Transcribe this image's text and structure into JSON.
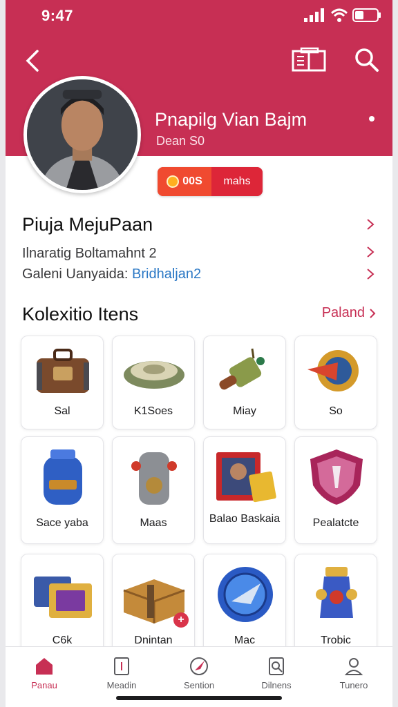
{
  "status_bar": {
    "time": "9:47"
  },
  "header": {
    "back_icon": "chevron-left-icon",
    "book_icon": "book-icon",
    "search_icon": "search-icon"
  },
  "profile": {
    "name": "Pnapilg Vian Bajm",
    "subtitle": "Dean S0",
    "badge_left": "00S",
    "badge_right": "mahs"
  },
  "info": {
    "heading": "Piuja MejuPaan",
    "rows": [
      {
        "text": "Ilnaratig Boltamahnt 2",
        "highlight": ""
      },
      {
        "label": "Galeni Uanyaida:",
        "highlight": "Bridhaljan2"
      }
    ]
  },
  "collection": {
    "title": "Kolexitio Itens",
    "link": "Paland",
    "items": [
      {
        "label": "Sal",
        "icon": "suitcase-icon"
      },
      {
        "label": "K1Soes",
        "icon": "disc-artifact-icon"
      },
      {
        "label": "Miay",
        "icon": "scroll-rod-icon"
      },
      {
        "label": "So",
        "icon": "winged-emblem-icon"
      },
      {
        "label": "Sace yaba",
        "icon": "blue-jar-icon"
      },
      {
        "label": "Maas",
        "icon": "armor-icon"
      },
      {
        "label": "Balao Baskaia",
        "icon": "portrait-card-icon"
      },
      {
        "label": "Pealatcte",
        "icon": "shield-crest-icon"
      },
      {
        "label": "C6k",
        "icon": "card-pack-icon"
      },
      {
        "label": "Dnintan",
        "icon": "wooden-crate-icon"
      },
      {
        "label": "Mac",
        "icon": "blue-medal-icon"
      },
      {
        "label": "Trobic",
        "icon": "trophy-vase-icon"
      }
    ]
  },
  "tabbar": {
    "tabs": [
      {
        "label": "Panau",
        "icon": "home-icon",
        "active": true
      },
      {
        "label": "Meadin",
        "icon": "document-icon",
        "active": false
      },
      {
        "label": "Sention",
        "icon": "compass-icon",
        "active": false
      },
      {
        "label": "Dilnens",
        "icon": "search-doc-icon",
        "active": false
      },
      {
        "label": "Tunero",
        "icon": "profile-icon",
        "active": false
      }
    ]
  },
  "colors": {
    "brand": "#c72f54",
    "badge": "#e8303a",
    "link": "#2b78c5"
  }
}
